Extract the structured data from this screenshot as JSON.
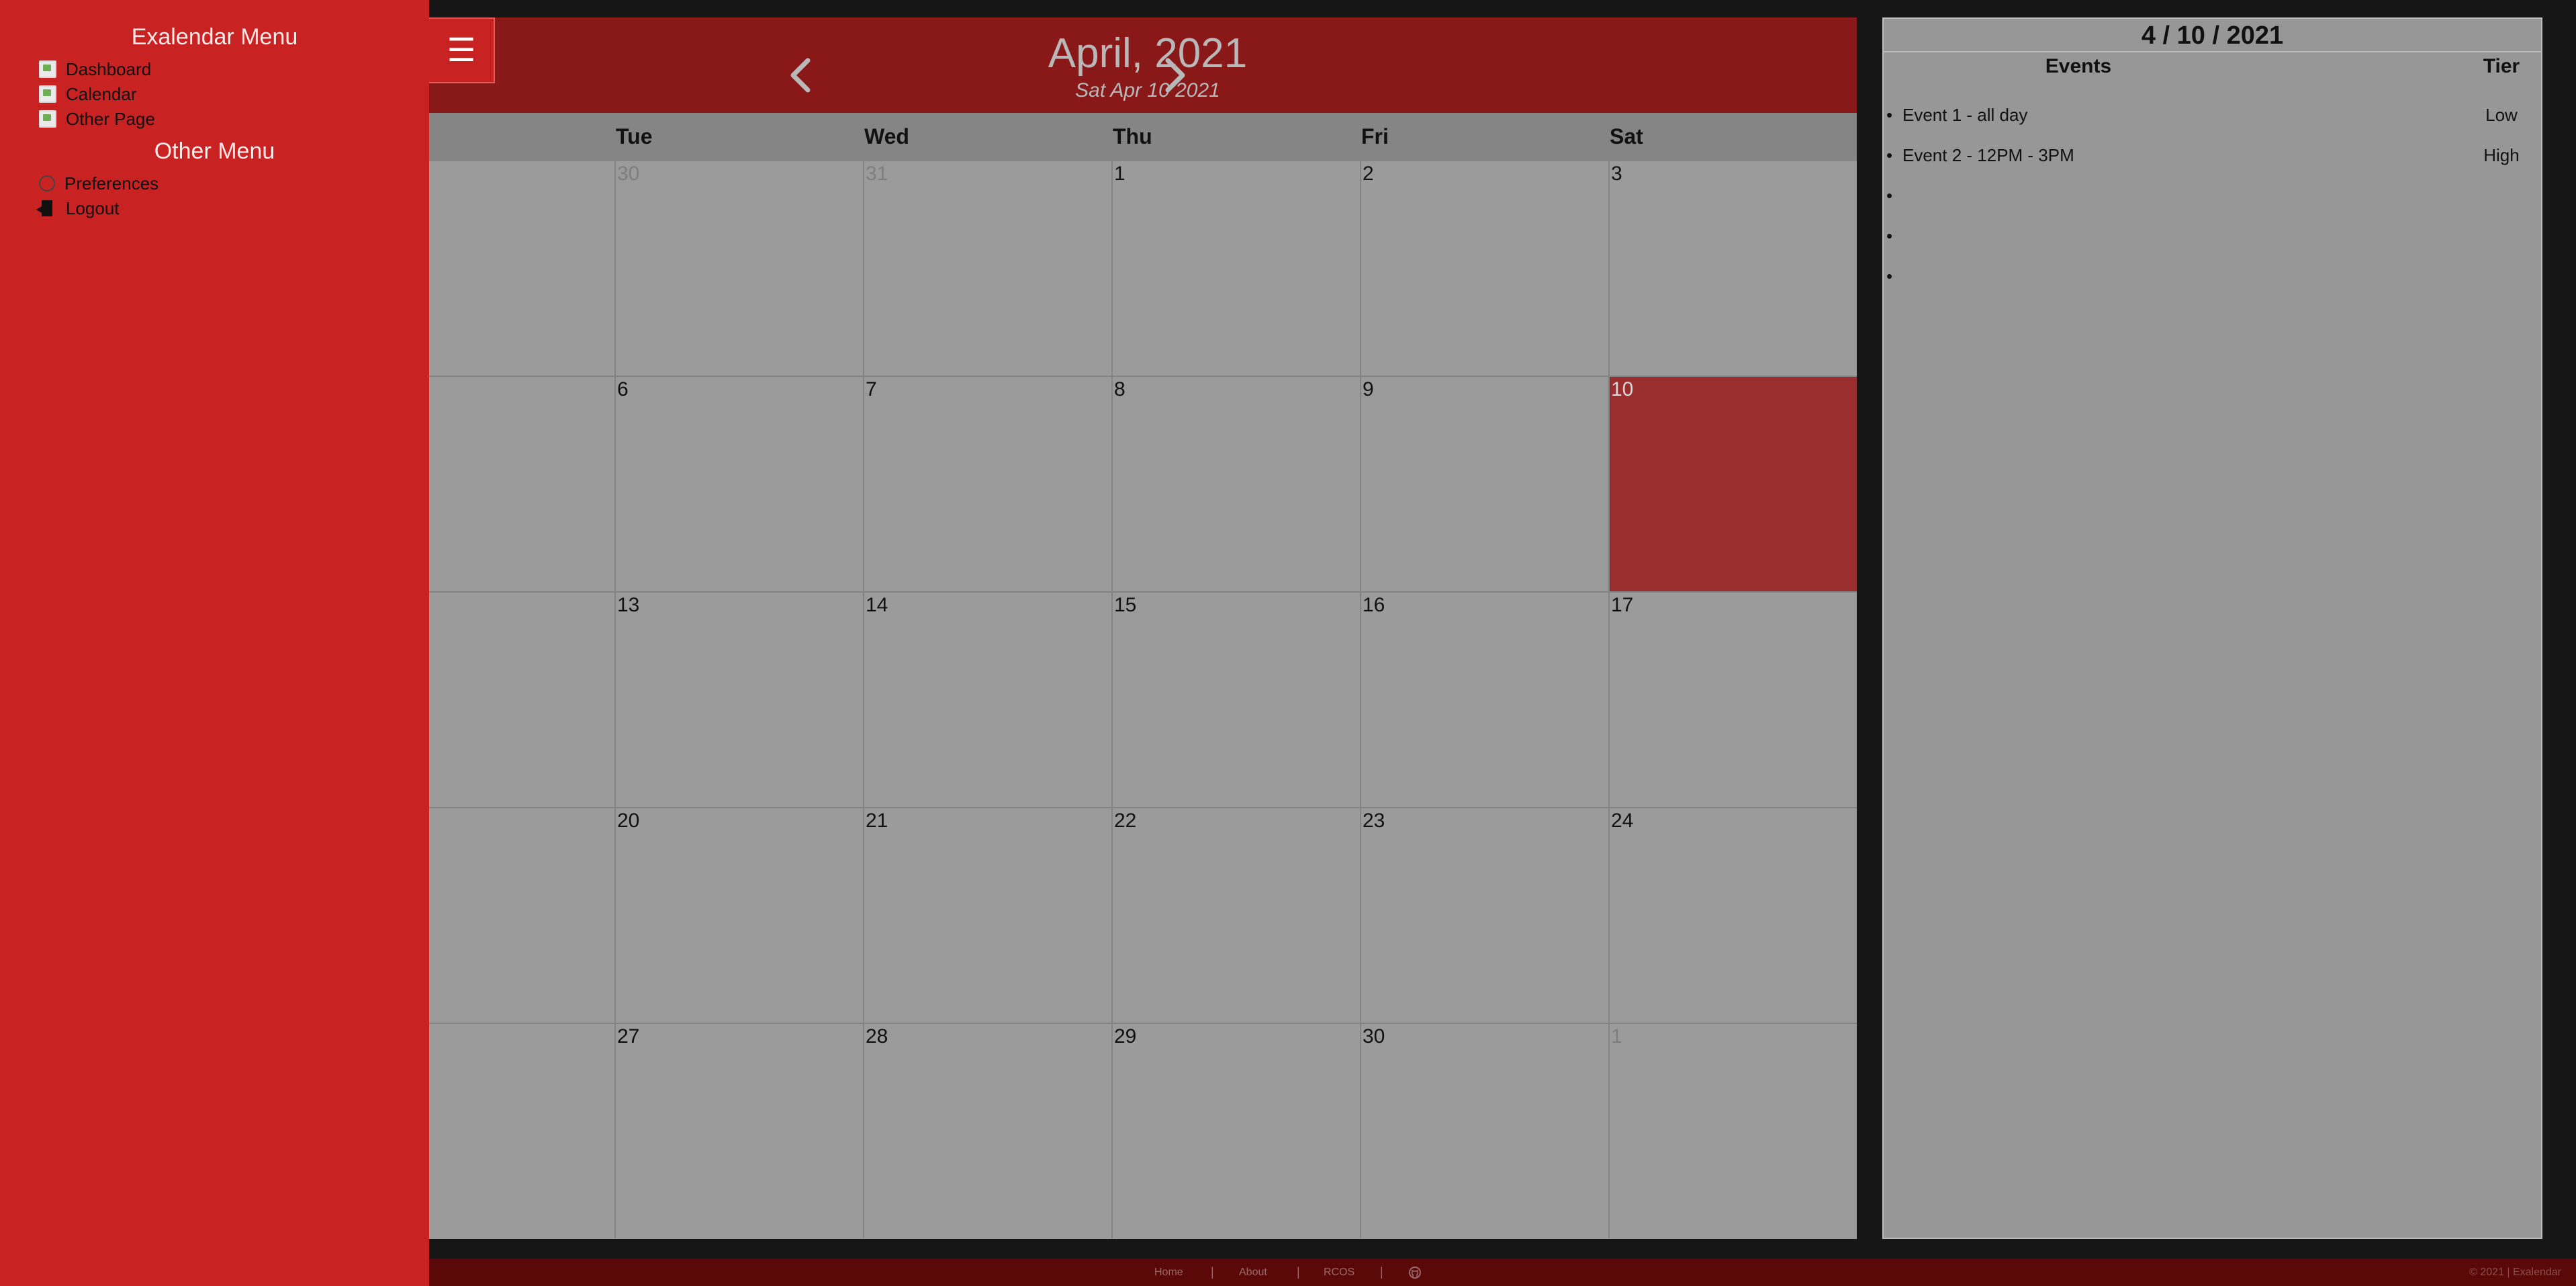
{
  "sidebar": {
    "title": "Exalendar Menu",
    "items": [
      {
        "label": "Dashboard",
        "icon": "broken-image-icon"
      },
      {
        "label": "Calendar",
        "icon": "broken-image-icon"
      },
      {
        "label": "Other Page",
        "icon": "broken-image-icon"
      }
    ],
    "other_title": "Other Menu",
    "other_items": [
      {
        "label": "Preferences",
        "icon": "circle-icon"
      },
      {
        "label": "Logout",
        "icon": "logout-door-icon"
      }
    ]
  },
  "calendar": {
    "menu_button": "☰",
    "month_title": "April, 2021",
    "selected_label": "Sat Apr 10 2021",
    "weekdays": [
      "Tue",
      "Wed",
      "Thu",
      "Fri",
      "Sat"
    ],
    "weeks": [
      [
        {
          "n": "30",
          "muted": true
        },
        {
          "n": "31",
          "muted": true
        },
        {
          "n": "1"
        },
        {
          "n": "2"
        },
        {
          "n": "3"
        }
      ],
      [
        {
          "n": "6"
        },
        {
          "n": "7"
        },
        {
          "n": "8"
        },
        {
          "n": "9"
        },
        {
          "n": "10",
          "selected": true
        }
      ],
      [
        {
          "n": "13"
        },
        {
          "n": "14"
        },
        {
          "n": "15"
        },
        {
          "n": "16"
        },
        {
          "n": "17"
        }
      ],
      [
        {
          "n": "20"
        },
        {
          "n": "21"
        },
        {
          "n": "22"
        },
        {
          "n": "23"
        },
        {
          "n": "24"
        }
      ],
      [
        {
          "n": "27"
        },
        {
          "n": "28"
        },
        {
          "n": "29"
        },
        {
          "n": "30"
        },
        {
          "n": "1",
          "muted": true
        }
      ]
    ],
    "colors": {
      "header": "#891818",
      "selected_day": "#9a2e2e",
      "sidebar": "#c82222"
    }
  },
  "details": {
    "date": "4 / 10 / 2021",
    "events_header": "Events",
    "tier_header": "Tier",
    "events": [
      {
        "text": "Event 1 - all day",
        "tier": "Low"
      },
      {
        "text": "Event 2 - 12PM - 3PM",
        "tier": "High"
      },
      {
        "text": "",
        "tier": ""
      },
      {
        "text": "",
        "tier": ""
      },
      {
        "text": "",
        "tier": ""
      }
    ]
  },
  "footer": {
    "links": [
      "Home",
      "About",
      "RCOS"
    ],
    "separator": "|",
    "github_icon": "github-icon",
    "copyright": "© 2021 | Exalendar"
  }
}
